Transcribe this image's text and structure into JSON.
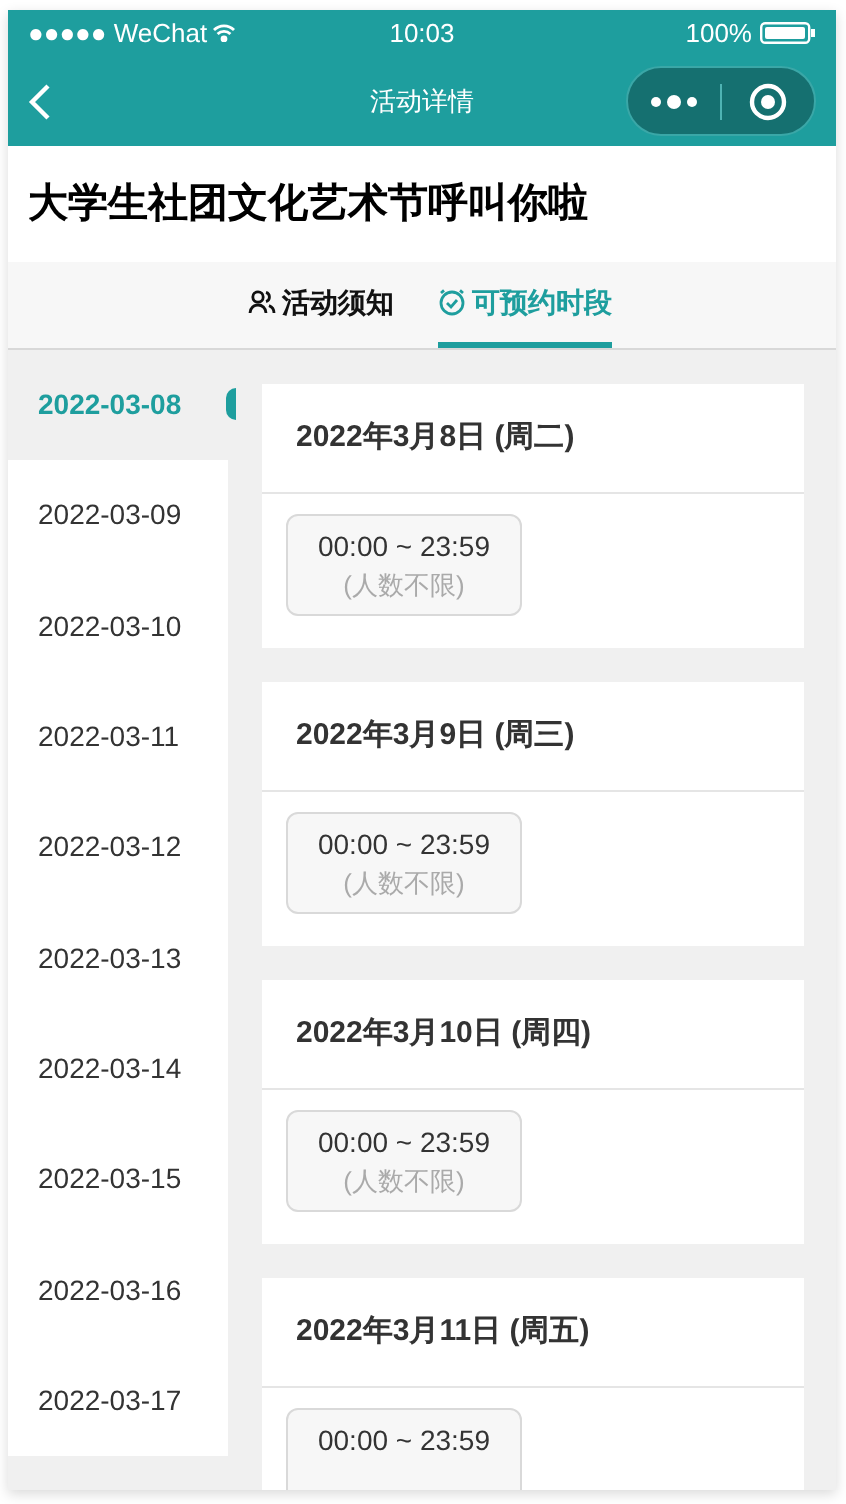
{
  "status_bar": {
    "carrier": "●●●●● WeChat",
    "time": "10:03",
    "battery": "100%"
  },
  "nav_bar": {
    "title": "活动详情"
  },
  "event_title": "大学生社团文化艺术节呼叫你啦",
  "tabs": [
    {
      "label": "活动须知",
      "kind": "people",
      "selected": false
    },
    {
      "label": "可预约时段",
      "kind": "clock",
      "selected": true
    }
  ],
  "dates": [
    {
      "label": "2022-03-08",
      "selected": true
    },
    {
      "label": "2022-03-09",
      "selected": false
    },
    {
      "label": "2022-03-10",
      "selected": false
    },
    {
      "label": "2022-03-11",
      "selected": false
    },
    {
      "label": "2022-03-12",
      "selected": false
    },
    {
      "label": "2022-03-13",
      "selected": false
    },
    {
      "label": "2022-03-14",
      "selected": false
    },
    {
      "label": "2022-03-15",
      "selected": false
    },
    {
      "label": "2022-03-16",
      "selected": false
    },
    {
      "label": "2022-03-17",
      "selected": false
    }
  ],
  "days": [
    {
      "heading": "2022年3月8日 (周二)",
      "slots": [
        {
          "time": "00:00 ~ 23:59",
          "capacity": "(人数不限)"
        }
      ]
    },
    {
      "heading": "2022年3月9日 (周三)",
      "slots": [
        {
          "time": "00:00 ~ 23:59",
          "capacity": "(人数不限)"
        }
      ]
    },
    {
      "heading": "2022年3月10日 (周四)",
      "slots": [
        {
          "time": "00:00 ~ 23:59",
          "capacity": "(人数不限)"
        }
      ]
    },
    {
      "heading": "2022年3月11日 (周五)",
      "slots": [
        {
          "time": "00:00 ~ 23:59"
        }
      ]
    }
  ]
}
